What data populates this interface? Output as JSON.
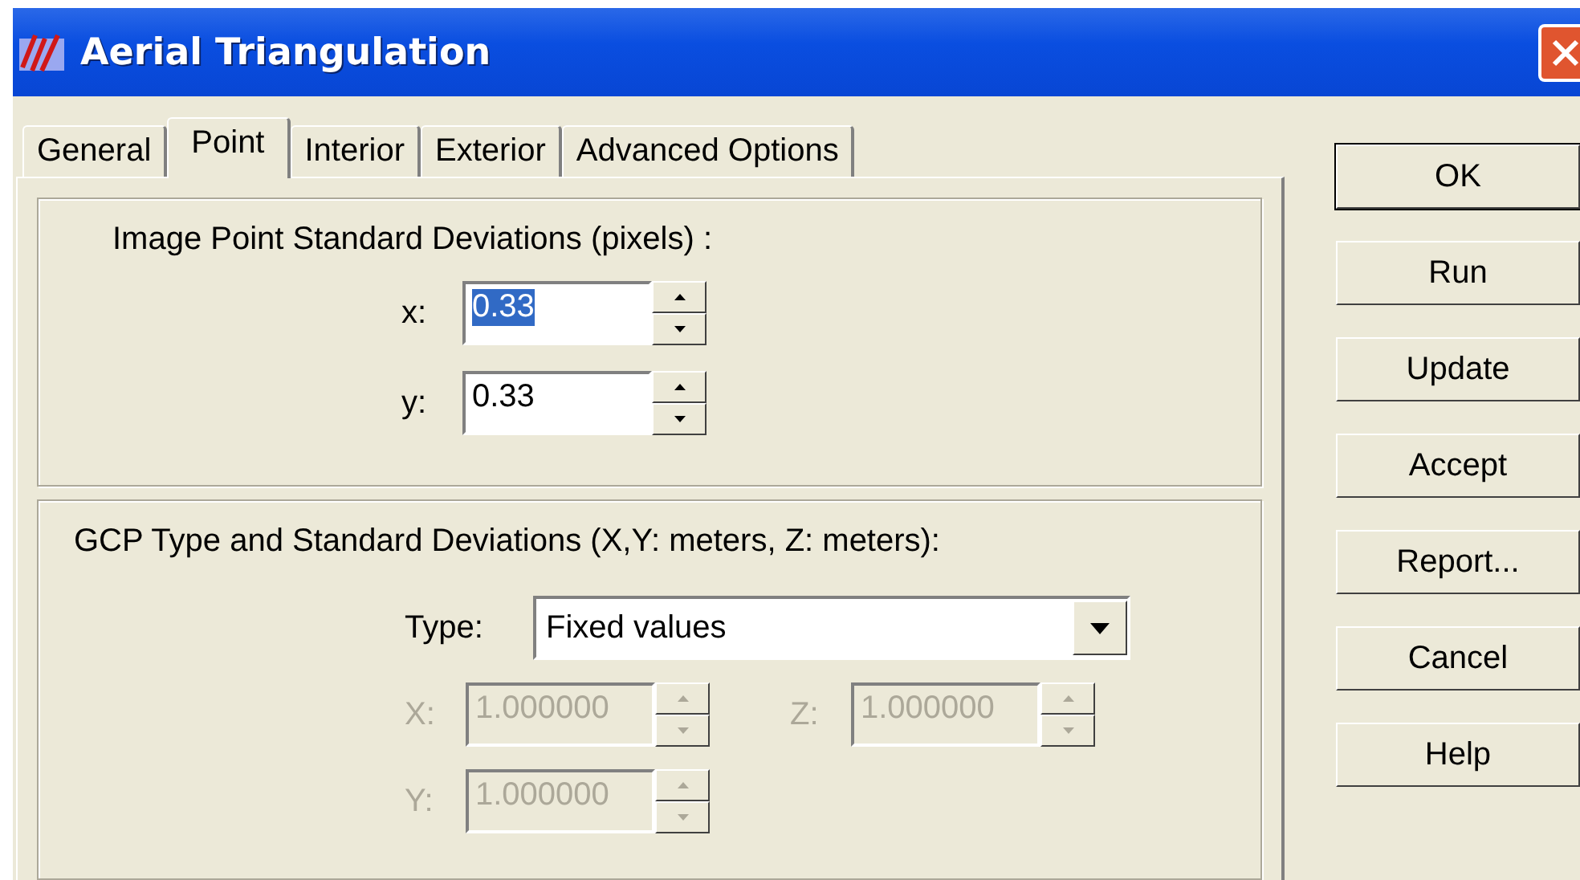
{
  "window": {
    "title": "Aerial Triangulation"
  },
  "tabs": [
    {
      "label": "General",
      "selected": false
    },
    {
      "label": "Point",
      "selected": true
    },
    {
      "label": "Interior",
      "selected": false
    },
    {
      "label": "Exterior",
      "selected": false
    },
    {
      "label": "Advanced Options",
      "selected": false
    }
  ],
  "image_point_group": {
    "title": "Image Point Standard Deviations (pixels) :",
    "fields": [
      {
        "label": "x:",
        "value": "0.33",
        "text_selected": true,
        "disabled": false
      },
      {
        "label": "y:",
        "value": "0.33",
        "text_selected": false,
        "disabled": false
      }
    ]
  },
  "gcp_group": {
    "title": "GCP Type and Standard Deviations (X,Y: meters, Z: meters):",
    "type_label": "Type:",
    "type_value": "Fixed values",
    "fields": [
      {
        "label": "X:",
        "value": "1.000000",
        "text_selected": false,
        "disabled": true
      },
      {
        "label": "Z:",
        "value": "1.000000",
        "text_selected": false,
        "disabled": true
      },
      {
        "label": "Y:",
        "value": "1.000000",
        "text_selected": false,
        "disabled": true
      }
    ]
  },
  "buttons": [
    {
      "label": "OK",
      "default": true
    },
    {
      "label": "Run",
      "default": false
    },
    {
      "label": "Update",
      "default": false
    },
    {
      "label": "Accept",
      "default": false
    },
    {
      "label": "Report...",
      "default": false
    },
    {
      "label": "Cancel",
      "default": false
    },
    {
      "label": "Help",
      "default": false
    }
  ]
}
